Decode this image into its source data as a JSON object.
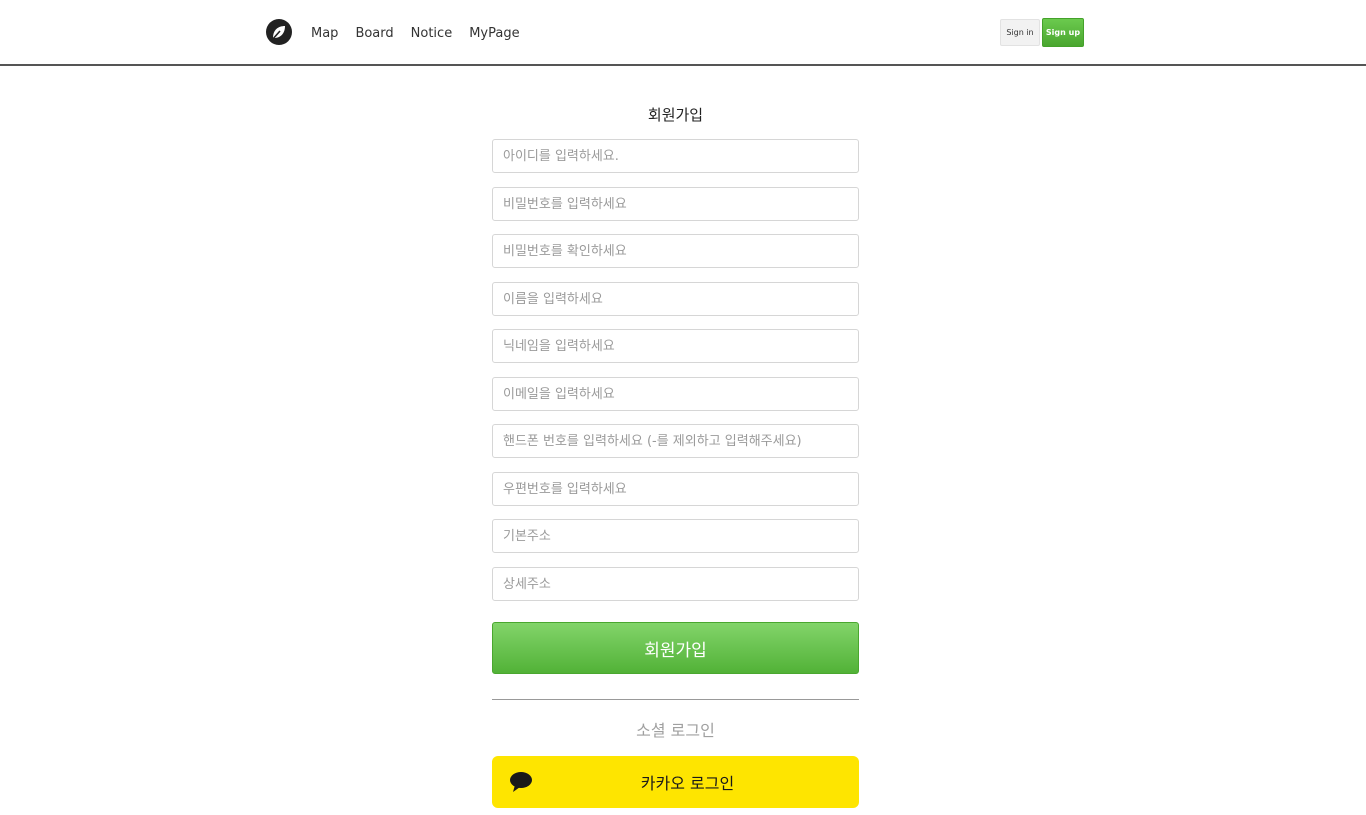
{
  "nav": {
    "links": [
      "Map",
      "Board",
      "Notice",
      "MyPage"
    ],
    "signin_label": "Sign in",
    "signup_label": "Sign up"
  },
  "form": {
    "title": "회원가입",
    "fields": [
      {
        "placeholder": "아이디를 입력하세요.",
        "value": ""
      },
      {
        "placeholder": "비밀번호를 입력하세요",
        "value": ""
      },
      {
        "placeholder": "비밀번호를 확인하세요",
        "value": ""
      },
      {
        "placeholder": "이름을 입력하세요",
        "value": ""
      },
      {
        "placeholder": "닉네임을 입력하세요",
        "value": ""
      },
      {
        "placeholder": "이메일을 입력하세요",
        "value": ""
      },
      {
        "placeholder": "핸드폰 번호를 입력하세요 (-를 제외하고 입력해주세요)",
        "value": ""
      },
      {
        "placeholder": "우편번호를 입력하세요",
        "value": ""
      },
      {
        "placeholder": "기본주소",
        "value": ""
      },
      {
        "placeholder": "상세주소",
        "value": ""
      }
    ],
    "submit_label": "회원가입"
  },
  "social": {
    "title": "소셜 로그인",
    "kakao_label": "카카오 로그인",
    "kakao_icon": "speech-bubble-icon"
  },
  "colors": {
    "accent_green": "#5bbb3f",
    "kakao_yellow": "#fee500"
  }
}
